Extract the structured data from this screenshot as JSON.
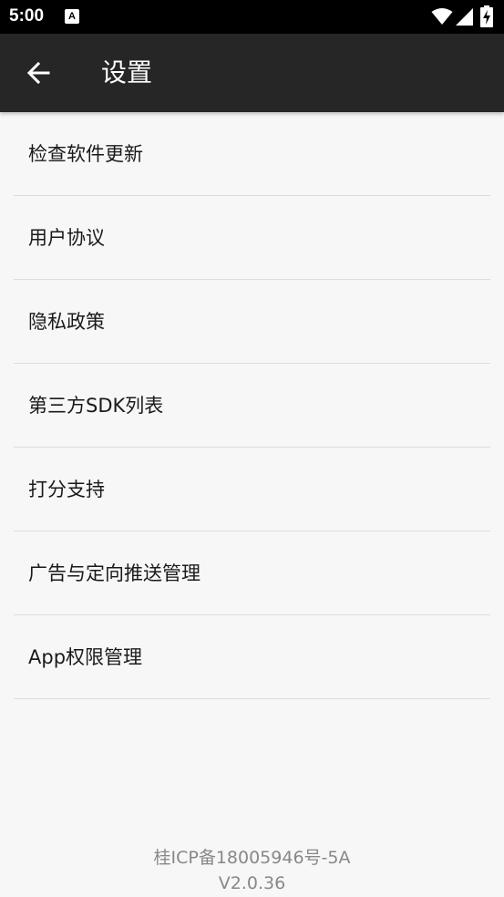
{
  "status_bar": {
    "time": "5:00",
    "icons": [
      "notification-a-icon",
      "wifi-icon",
      "cellular-signal-icon",
      "battery-charging-icon"
    ]
  },
  "app_bar": {
    "back_icon": "arrow-left-icon",
    "title": "设置",
    "background": "#262626"
  },
  "settings": {
    "items": [
      {
        "label": "检查软件更新"
      },
      {
        "label": "用户协议"
      },
      {
        "label": "隐私政策"
      },
      {
        "label": "第三方SDK列表"
      },
      {
        "label": "打分支持"
      },
      {
        "label": "广告与定向推送管理"
      },
      {
        "label": "App权限管理"
      }
    ]
  },
  "footer": {
    "icp": "桂ICP备18005946号-5A",
    "version": "V2.0.36"
  }
}
